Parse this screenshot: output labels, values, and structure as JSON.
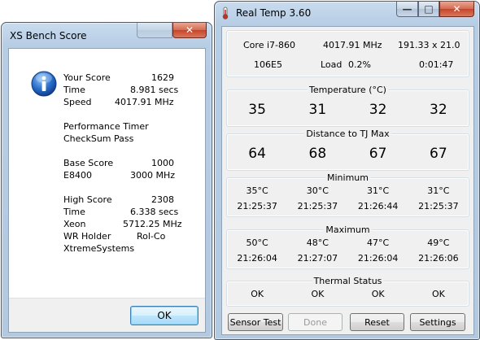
{
  "xs_bench": {
    "title": "XS Bench Score",
    "close_glyph": "✕",
    "lines": [
      {
        "label": "Your Score",
        "value": "1629"
      },
      {
        "label": "Time",
        "value": "8.981 secs"
      },
      {
        "label": "Speed",
        "value": "4017.91 MHz"
      },
      {
        "gap": true
      },
      {
        "label": "Performance Timer",
        "value": ""
      },
      {
        "label": "CheckSum Pass",
        "value": ""
      },
      {
        "gap": true
      },
      {
        "label": "Base Score",
        "value": "1000"
      },
      {
        "label": "E8400",
        "value": "3000 MHz"
      },
      {
        "gap": true
      },
      {
        "label": "High Score",
        "value": "2308"
      },
      {
        "label": "Time",
        "value": "6.338 secs"
      },
      {
        "label": "Xeon",
        "value": "5712.25 MHz"
      },
      {
        "label": "WR Holder",
        "value": "Rol-Co"
      },
      {
        "label": "XtremeSystems",
        "value": ""
      }
    ],
    "ok_label": "OK"
  },
  "real_temp": {
    "title": "Real Temp 3.60",
    "min_glyph": "—",
    "max_glyph": "□",
    "close_glyph": "✕",
    "info": {
      "cpu": "Core i7-860",
      "freq": "4017.91 MHz",
      "multiplier": "191.33 x 21.0",
      "stepping": "106E5",
      "load_label": "Load",
      "load_value": "0.2%",
      "uptime": "0:01:47"
    },
    "temperature": {
      "title": "Temperature (°C)",
      "values": [
        "35",
        "31",
        "32",
        "32"
      ]
    },
    "distance": {
      "title": "Distance to TJ Max",
      "values": [
        "64",
        "68",
        "67",
        "67"
      ]
    },
    "minimum": {
      "title": "Minimum",
      "temps": [
        "35°C",
        "30°C",
        "31°C",
        "31°C"
      ],
      "times": [
        "21:25:37",
        "21:25:37",
        "21:26:44",
        "21:25:37"
      ]
    },
    "maximum": {
      "title": "Maximum",
      "temps": [
        "50°C",
        "48°C",
        "47°C",
        "49°C"
      ],
      "times": [
        "21:26:04",
        "21:27:07",
        "21:26:04",
        "21:26:06"
      ]
    },
    "thermal": {
      "title": "Thermal Status",
      "values": [
        "OK",
        "OK",
        "OK",
        "OK"
      ]
    },
    "buttons": {
      "sensor_test": "Sensor Test",
      "done": "Done",
      "reset": "Reset",
      "settings": "Settings"
    }
  },
  "colors": {
    "window_frame": "#b7cde4",
    "close_button": "#c4442a",
    "ok_button": "#bee6fd"
  },
  "icons": {
    "xs_dialog": "info-icon",
    "real_temp": "thermometer-icon"
  }
}
